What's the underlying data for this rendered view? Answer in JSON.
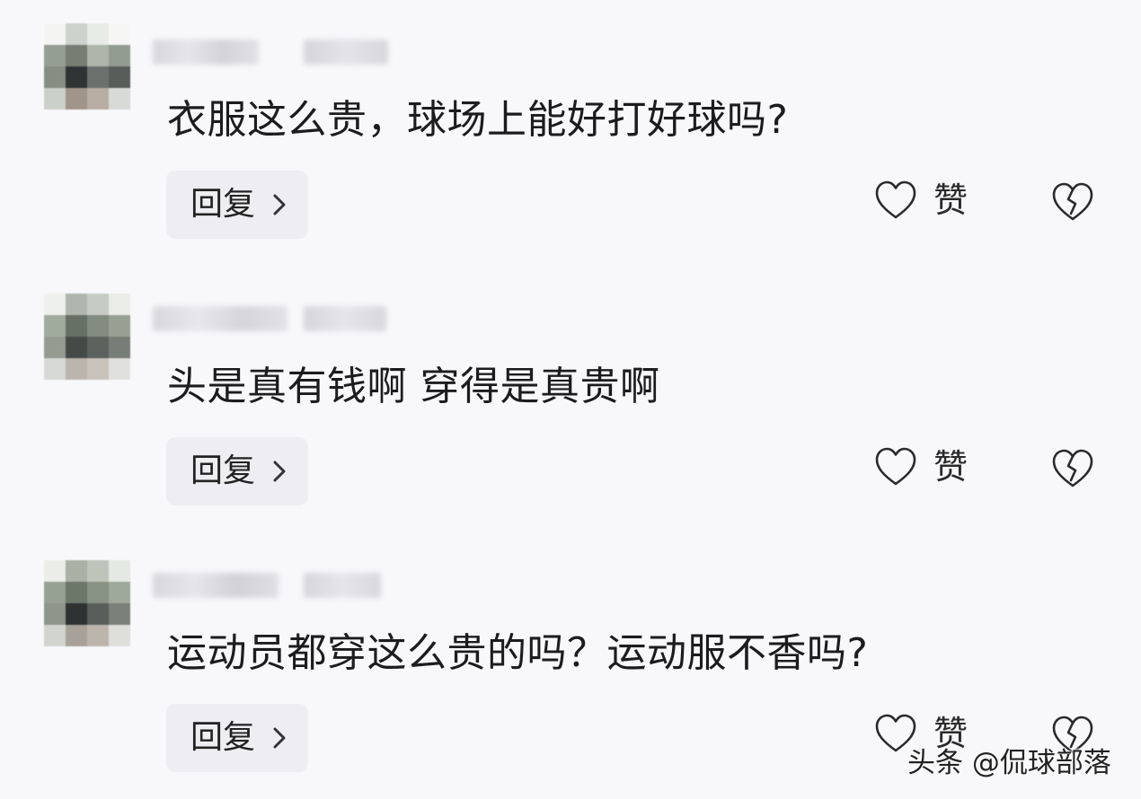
{
  "comments": [
    {
      "text": "衣服这么贵，球场上能好打好球吗?",
      "reply_label": "回复",
      "like_label": "赞"
    },
    {
      "text": "头是真有钱啊 穿得是真贵啊",
      "reply_label": "回复",
      "like_label": "赞"
    },
    {
      "text": "运动员都穿这么贵的吗？运动服不香吗?",
      "reply_label": "回复",
      "like_label": "赞"
    }
  ],
  "watermark": "头条 @侃球部落",
  "icons": {
    "reply_chevron": "chevron-right-icon",
    "like": "heart-outline-icon",
    "dislike": "broken-heart-icon"
  },
  "colors": {
    "background": "#f8f8fb",
    "reply_button_bg": "#eeeef2",
    "text": "#1c1c1e",
    "icon_stroke": "#2a2a2a"
  }
}
